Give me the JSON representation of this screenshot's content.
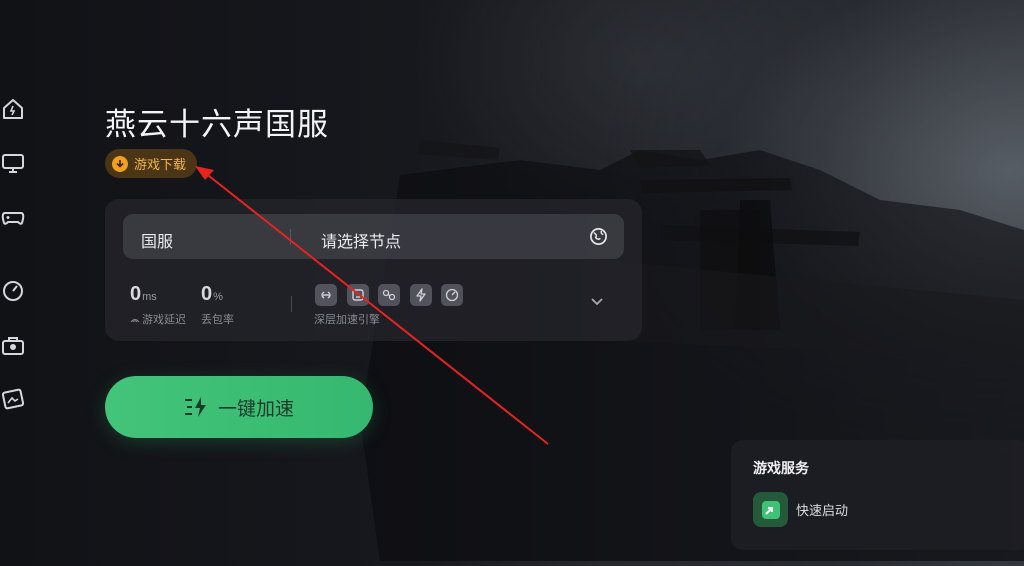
{
  "sidebar": {
    "items": [
      {
        "icon": "home-icon"
      },
      {
        "icon": "monitor-icon"
      },
      {
        "icon": "gamepad-icon"
      },
      {
        "icon": "speedometer-icon"
      },
      {
        "icon": "toolbox-icon"
      },
      {
        "icon": "image-card-icon"
      }
    ]
  },
  "game": {
    "title": "燕云十六声国服",
    "download_label": "游戏下载"
  },
  "panel": {
    "region": "国服",
    "node_placeholder": "请选择节点",
    "latency": {
      "value": "0",
      "unit": "ms",
      "caption": "游戏延迟"
    },
    "packet_loss": {
      "value": "0",
      "unit": "%",
      "caption": "丢包率"
    },
    "engine_caption": "深层加速引擎"
  },
  "accelerate_button": {
    "label": "一键加速"
  },
  "services": {
    "title": "游戏服务",
    "items": [
      {
        "label": "快速启动",
        "icon": "quick-launch-icon"
      }
    ]
  },
  "colors": {
    "accent_green": "#3fc276",
    "download_orange": "#f2a01e",
    "annotation_arrow": "#e52420"
  }
}
